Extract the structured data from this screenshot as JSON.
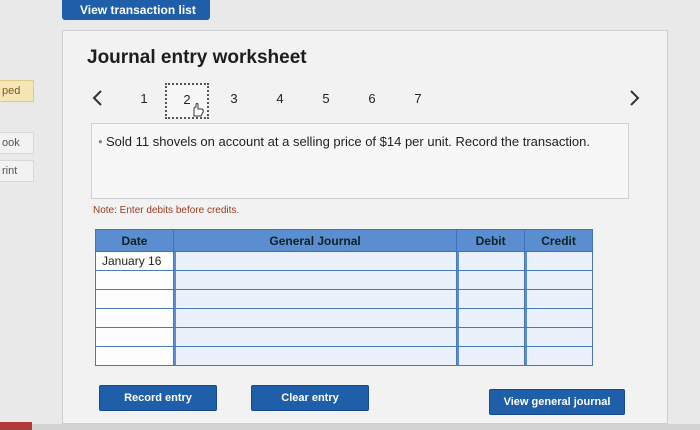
{
  "top_bar": {
    "view_transaction_list": "View transaction list"
  },
  "left_tabs": [
    {
      "label": "ped",
      "highlight": true
    },
    {
      "label": "ook",
      "highlight": false
    },
    {
      "label": "rint",
      "highlight": false
    }
  ],
  "worksheet": {
    "title": "Journal entry worksheet",
    "pager": {
      "prev_icon": "chevron-left-icon",
      "next_icon": "chevron-right-icon",
      "pages": [
        "1",
        "2",
        "3",
        "4",
        "5",
        "6",
        "7"
      ],
      "current_page": "2"
    },
    "prompt": "Sold 11 shovels on account at a selling price of $14 per unit. Record the transaction.",
    "note": "Note: Enter debits before credits.",
    "table": {
      "headers": {
        "date": "Date",
        "general_journal": "General Journal",
        "debit": "Debit",
        "credit": "Credit"
      },
      "rows": [
        {
          "date": "January 16",
          "general_journal": "",
          "debit": "",
          "credit": ""
        },
        {
          "date": "",
          "general_journal": "",
          "debit": "",
          "credit": ""
        },
        {
          "date": "",
          "general_journal": "",
          "debit": "",
          "credit": ""
        },
        {
          "date": "",
          "general_journal": "",
          "debit": "",
          "credit": ""
        },
        {
          "date": "",
          "general_journal": "",
          "debit": "",
          "credit": ""
        },
        {
          "date": "",
          "general_journal": "",
          "debit": "",
          "credit": ""
        }
      ]
    },
    "buttons": {
      "record_entry": "Record entry",
      "clear_entry": "Clear entry",
      "view_general_journal": "View general journal"
    }
  },
  "colors": {
    "primary_button": "#1f5ea8",
    "table_header": "#5a8ed0",
    "note_text": "#9a3b1d"
  }
}
